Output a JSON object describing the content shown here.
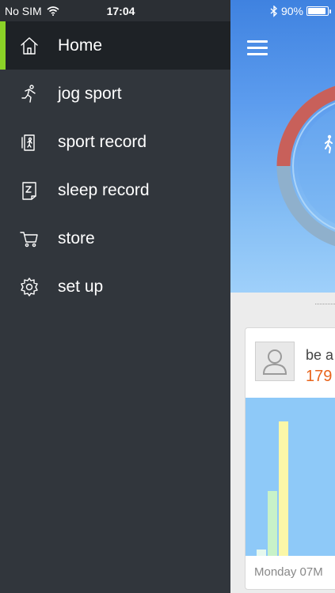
{
  "status_bar": {
    "carrier": "No SIM",
    "time": "17:04",
    "battery_percent": "90%",
    "battery_level": 0.9,
    "icons": [
      "wifi-icon",
      "bluetooth-icon",
      "battery-icon"
    ]
  },
  "sidebar": {
    "accent_color": "#8bd227",
    "items": [
      {
        "label": "Home",
        "icon": "home-icon",
        "active": true
      },
      {
        "label": "jog sport",
        "icon": "running-icon"
      },
      {
        "label": "sport record",
        "icon": "sport-record-icon"
      },
      {
        "label": "sleep record",
        "icon": "sleep-record-icon"
      },
      {
        "label": "store",
        "icon": "cart-icon"
      },
      {
        "label": "set up",
        "icon": "gear-icon"
      }
    ]
  },
  "main": {
    "menu_icon": "hamburger-icon",
    "ring_colors": {
      "progress": "#c8605a",
      "track": "#8fb0cc"
    },
    "card": {
      "name_text": "be a",
      "steps_text": "179",
      "date_text": "Monday 07M",
      "chart_data": {
        "type": "bar",
        "values": [
          4,
          41,
          85
        ],
        "colors": [
          "#e6f8ee",
          "#c8f2c8",
          "#fbf7a8"
        ]
      }
    }
  }
}
